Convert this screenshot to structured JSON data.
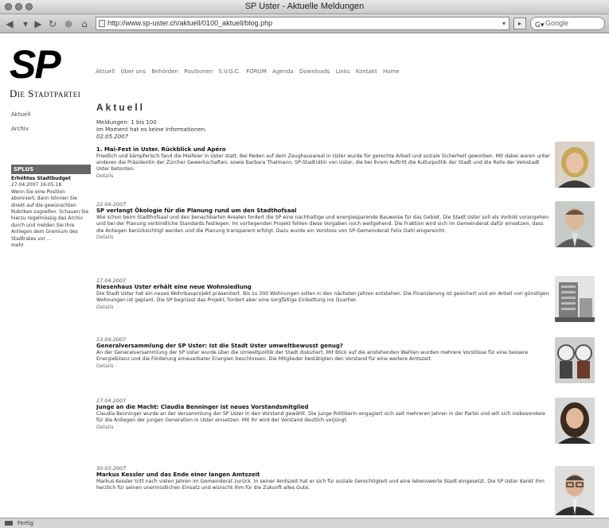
{
  "window": {
    "title": "SP Uster - Aktuelle Meldungen"
  },
  "toolbar": {
    "url": "http://www.sp-uster.ch/aktuell/0100_aktuell/blog.php",
    "search_placeholder": "Google"
  },
  "logo": {
    "mark": "SP",
    "sub": "Die Stadtpartei"
  },
  "topnav": [
    "Aktuell",
    "Über uns",
    "Behörden",
    "Positionen",
    "S.V.G.C.",
    "FORUM",
    "Agenda",
    "Downloads",
    "Links",
    "Kontakt",
    "Home"
  ],
  "sidebar": {
    "links": [
      "Aktuell",
      "Archiv"
    ],
    "box_title": "SPLUS",
    "box_entry_title": "Erhöhtes Stadtbudget",
    "box_entry_date": "27.04.2007 16:05:18",
    "box_entry_text": "Wenn Sie eine Position abonniert, dann können Sie direkt auf die gewünschten Rubriken zugreifen. Schauen Sie hierzu regelmässig das Archiv durch und melden Sie Ihre Anliegen dem Gremium des Stadtrates vor ...",
    "box_more": "mehr"
  },
  "main": {
    "heading": "Aktuell",
    "meta_line1": "Meldungen: 1 bis 100",
    "meta_line2": "Im Moment hat es keine Informationen.",
    "meta_date": "02.05.2007"
  },
  "news": [
    {
      "date": "",
      "title": "1. Mai-Fest in Uster. Rückblick und Apéro",
      "body": "Friedlich und kämpferisch fand die Maifeier in Uster statt. Bei Reden auf dem Zeughausareal in Uster wurde für gerechte Arbeit und soziale Sicherheit geworben. Mit dabei waren unter anderen die Präsidentin der Zürcher Gewerkschaften, sowie Barbara Thalmann, SP-Stadträtin von Uster, die bei ihrem Auftritt die Kulturpolitik der Stadt und die Rolle der Velostadt Uster betonten.",
      "more": "Details"
    },
    {
      "date": "22.04.2007",
      "title": "SP verlangt Ökologie für die Planung rund um den Stadthofsaal",
      "body": "Wie schon beim Stadthofsaal und den benachbarten Arealen fordert die SP eine nachhaltige und energiesparende Bauweise für das Gebiet. Die Stadt Uster soll als Vorbild vorangehen und bei der Planung verbindliche Standards festlegen. Im vorliegenden Projekt fehlen diese Vorgaben noch weitgehend. Die Fraktion wird sich im Gemeinderat dafür einsetzen, dass die Anliegen berücksichtigt werden und die Planung transparent erfolgt. Dazu wurde ein Vorstoss von SP-Gemeinderat Felix Dahl eingereicht.",
      "more": "Details"
    },
    {
      "date": "17.04.2007",
      "title": "Riesenhaus Uster erhält eine neue Wohnsiedlung",
      "body": "Die Stadt Uster hat ein neues Wohnbauprojekt präsentiert. Bis zu 300 Wohnungen sollen in den nächsten Jahren entstehen. Die Finanzierung ist gesichert und ein Anteil von günstigen Wohnungen ist geplant. Die SP begrüsst das Projekt, fordert aber eine sorgfältige Einbettung ins Quartier.",
      "more": "Details"
    },
    {
      "date": "13.04.2007",
      "title": "Generalversammlung der SP Uster: Ist die Stadt Uster umweltbewusst genug?",
      "body": "An der Generalversammlung der SP Uster wurde über die Umweltpolitik der Stadt diskutiert. Mit Blick auf die anstehenden Wahlen wurden mehrere Vorstösse für eine bessere Energiebilanz und die Förderung erneuerbarer Energien beschlossen. Die Mitglieder bestätigten den Vorstand für eine weitere Amtszeit.",
      "more": "Details"
    },
    {
      "date": "17.04.2007",
      "title": "Junge an die Macht: Claudia Benninger ist neues Vorstandsmitglied",
      "body": "Claudia Benninger wurde an der Versammlung der SP Uster in den Vorstand gewählt. Die junge Politikerin engagiert sich seit mehreren Jahren in der Partei und will sich insbesondere für die Anliegen der jungen Generation in Uster einsetzen. Mit ihr wird der Vorstand deutlich verjüngt.",
      "more": "Details"
    },
    {
      "date": "30.03.2007",
      "title": "Markus Kessler und das Ende einer langen Amtszeit",
      "body": "Markus Kessler tritt nach vielen Jahren im Gemeinderat zurück. In seiner Amtszeit hat er sich für soziale Gerechtigkeit und eine lebenswerte Stadt eingesetzt. Die SP Uster dankt ihm herzlich für seinen unermüdlichen Einsatz und wünscht ihm für die Zukunft alles Gute.",
      "more": "Details"
    }
  ],
  "statusbar": {
    "text": "Fertig"
  }
}
